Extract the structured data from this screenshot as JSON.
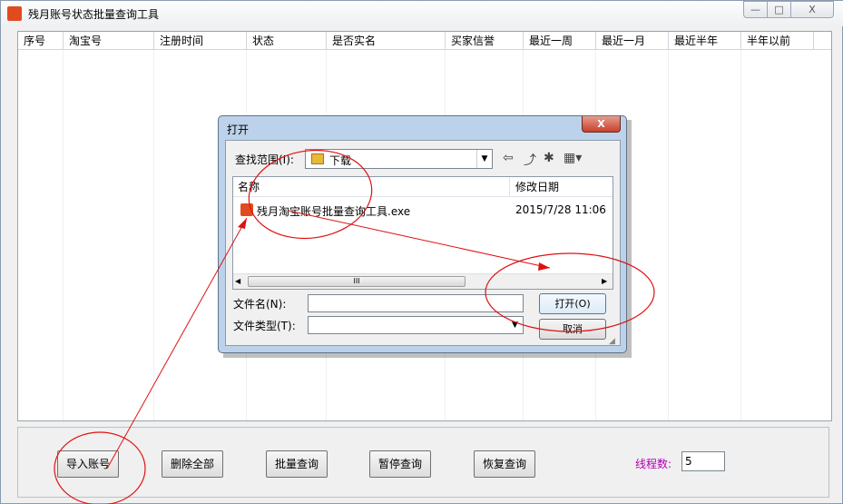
{
  "window": {
    "title": "残月账号状态批量查询工具",
    "min_label": "—",
    "max_label": "□",
    "close_label": "X"
  },
  "table": {
    "columns": [
      "序号",
      "淘宝号",
      "注册时间",
      "状态",
      "是否实名",
      "买家信誉",
      "最近一周",
      "最近一月",
      "最近半年",
      "半年以前"
    ],
    "rows": []
  },
  "buttons": {
    "import": "导入账号",
    "delete_all": "删除全部",
    "batch_query": "批量查询",
    "pause_query": "暂停查询",
    "resume_query": "恢复查询"
  },
  "threads": {
    "label": "线程数:",
    "value": "5"
  },
  "dialog": {
    "title": "打开",
    "close_label": "X",
    "lookin_label": "查找范围(I):",
    "lookin_value": "下载",
    "columns": {
      "name": "名称",
      "date": "修改日期"
    },
    "files": [
      {
        "name": "残月淘宝账号批量查询工具.exe",
        "date": "2015/7/28 11:06"
      }
    ],
    "scroll_grip": "III",
    "filename_label": "文件名(N):",
    "filename_value": "",
    "filetype_label": "文件类型(T):",
    "filetype_value": "",
    "open_button": "打开(O)",
    "cancel_button": "取消"
  },
  "colors": {
    "annotation": "#e01010",
    "thread_label": "#b000b0",
    "dialog_frame": "#bcd2ea"
  }
}
